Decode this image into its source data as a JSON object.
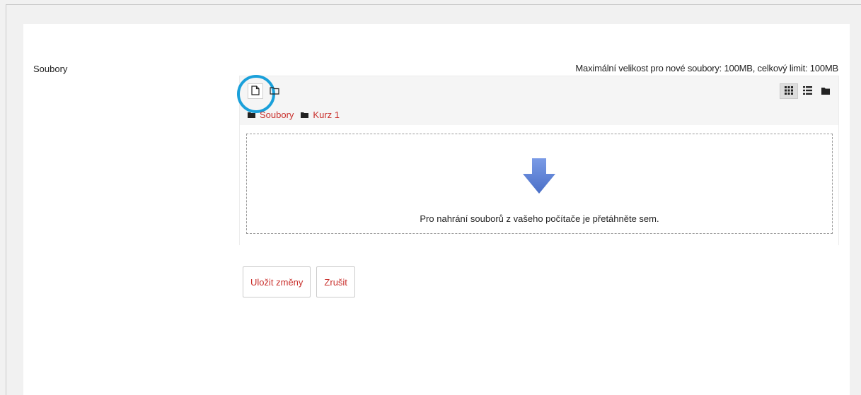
{
  "field": {
    "label": "Soubory"
  },
  "filemanager": {
    "limit_text": "Maximální velikost pro nové soubory: 100MB, celkový limit: 100MB",
    "path": [
      "Soubory",
      "Kurz 1"
    ],
    "drop_text": "Pro nahrání souborů z vašeho počítače je přetáhněte sem.",
    "toolbar": {
      "add_file_icon": "file-icon",
      "create_folder_icon": "folder-outline-icon",
      "views": [
        "view-icons-icon",
        "view-list-icon",
        "view-tree-icon"
      ],
      "active_view": "view-icons-icon"
    },
    "highlight_color": "#1aa0da",
    "arrow_color": "#5b7fd4"
  },
  "actions": {
    "save_label": "Uložit změny",
    "cancel_label": "Zrušit"
  },
  "colors": {
    "link": "#c9302c",
    "background": "#f1f1f1",
    "panel": "#ffffff"
  }
}
